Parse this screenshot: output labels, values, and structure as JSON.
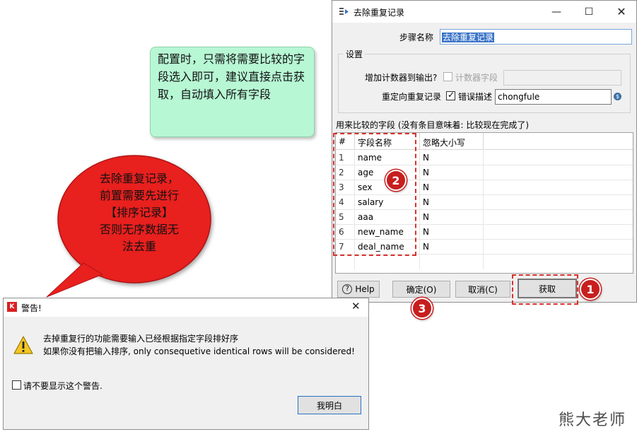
{
  "dialog": {
    "title": "去除重复记录",
    "min_glyph": "—",
    "max_glyph": "☐",
    "close_glyph": "✕",
    "step_name_label": "步骤名称",
    "step_name_value": "去除重复记录",
    "settings_group_title": "设置",
    "add_counter_label": "增加计数器到输出?",
    "counter_field_label": "计数器字段",
    "counter_field_value": "",
    "redirect_label": "重定向重复记录",
    "error_desc_label": "错误描述",
    "error_desc_value": "chongfule",
    "var_icon_glyph": "$",
    "fields_caption": "用来比较的字段 (没有条目意味着: 比较现在完成了)",
    "table": {
      "headers": [
        "#",
        "字段名称",
        "忽略大小写"
      ],
      "rows": [
        {
          "num": "1",
          "name": "name",
          "ignore": "N"
        },
        {
          "num": "2",
          "name": "age",
          "ignore": "N"
        },
        {
          "num": "3",
          "name": "sex",
          "ignore": "N"
        },
        {
          "num": "4",
          "name": "salary",
          "ignore": "N"
        },
        {
          "num": "5",
          "name": "aaa",
          "ignore": "N"
        },
        {
          "num": "6",
          "name": "new_name",
          "ignore": "N"
        },
        {
          "num": "7",
          "name": "deal_name",
          "ignore": "N"
        }
      ]
    },
    "buttons": {
      "help_glyph": "?",
      "help": "Help",
      "ok": "确定(O)",
      "cancel": "取消(C)",
      "get": "获取"
    }
  },
  "annotations": {
    "green_note": "配置时，只需将需要比较的字段选入即可，建议直接点击获取，自动填入所有字段",
    "red_callout_lines": [
      "去除重复记录，",
      "前置需要先进行",
      "【排序记录】",
      "否则无序数据无",
      "法去重"
    ],
    "badge_1": "1",
    "badge_2": "2",
    "badge_3": "3",
    "colors": {
      "callout_red": "#e8201e",
      "note_green": "#b7f7d4",
      "badge_red": "#c81e1e"
    }
  },
  "warning": {
    "title": "警告!",
    "app_icon_glyph": "K",
    "close_glyph": "✕",
    "line1": "去掉重复行的功能需要输入已经根据指定字段排好序",
    "line2": "如果你没有把输入排序, only consequetive identical rows will be considered!",
    "dont_show_label": "请不要显示这个警告.",
    "ok_button": "我明白"
  },
  "watermark": "熊大老师"
}
